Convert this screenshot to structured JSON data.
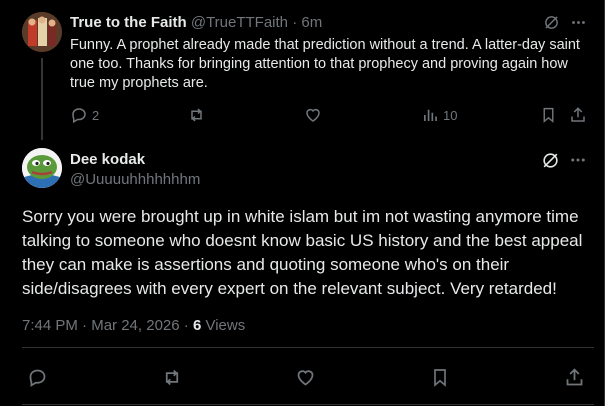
{
  "reply_post": {
    "display_name": "True to the Faith",
    "handle": "@TrueTTFaith",
    "separator": "·",
    "time_ago": "6m",
    "text": "Funny. A prophet already made that prediction without a trend. A latter-day saint one too. Thanks for bringing attention to that prophecy and proving again how true my prophets are.",
    "reply_count": "2",
    "views_count": "10",
    "icons": [
      "grok-icon",
      "more-icon",
      "reply-icon",
      "retweet-icon",
      "like-icon",
      "views-icon",
      "bookmark-icon",
      "share-icon"
    ]
  },
  "main_post": {
    "display_name": "Dee kodak",
    "handle": "@Uuuuuhhhhhhhm",
    "text": "Sorry you were brought up in white islam but im not wasting anymore time talking to someone who doesnt know basic US history and the best appeal they can make is assertions and quoting someone who's on their side/disagrees with every expert on the relevant subject. Very retarded!",
    "time": "7:44 PM",
    "date": "Mar 24, 2026",
    "separator": "·",
    "views_count": "6",
    "views_label": "Views",
    "icons": [
      "grok-icon",
      "more-icon",
      "reply-icon",
      "retweet-icon",
      "like-icon",
      "bookmark-icon",
      "share-icon"
    ]
  },
  "colors": {
    "background": "#000000",
    "text": "#e7e9ea",
    "muted": "#71767b",
    "divider": "#2f3336"
  }
}
